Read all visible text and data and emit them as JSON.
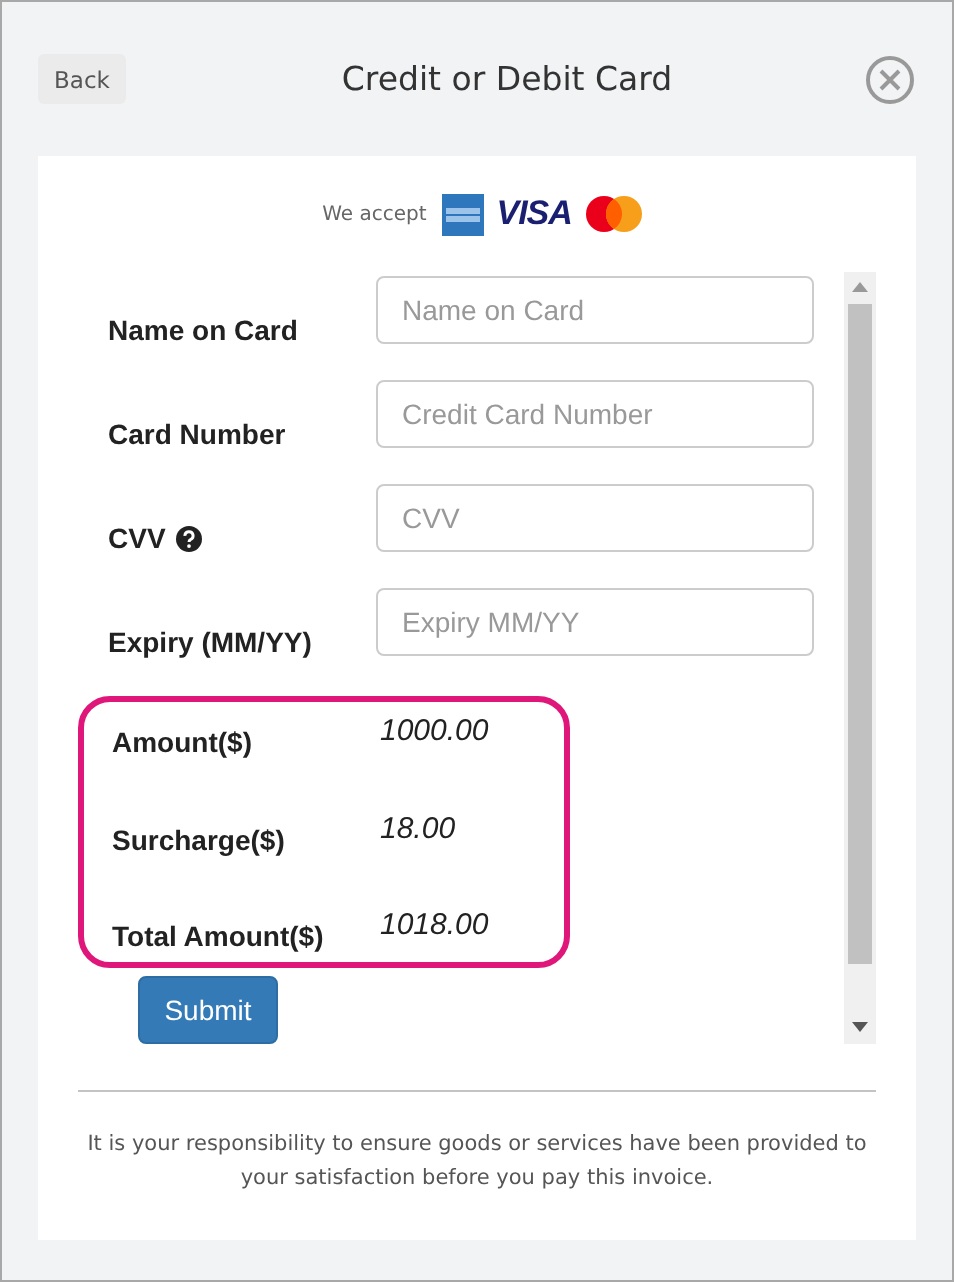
{
  "header": {
    "back_button": "Back",
    "title": "Credit or Debit Card"
  },
  "accepted": {
    "label": "We accept",
    "cards": [
      {
        "kind": "amex"
      },
      {
        "kind": "visa",
        "text": "VISA"
      },
      {
        "kind": "mastercard"
      }
    ]
  },
  "fields": [
    {
      "label": "Name on Card",
      "placeholder": "Name on Card",
      "help": false
    },
    {
      "label": "Card Number",
      "placeholder": "Credit Card Number",
      "help": false
    },
    {
      "label": "CVV",
      "placeholder": "CVV",
      "help": true
    },
    {
      "label": "Expiry (MM/YY)",
      "placeholder": "Expiry MM/YY",
      "help": false
    }
  ],
  "summary": [
    {
      "label": "Amount($)",
      "value": "1000.00"
    },
    {
      "label": "Surcharge($)",
      "value": "18.00"
    },
    {
      "label": "Total Amount($)",
      "value": "1018.00"
    }
  ],
  "submit_button": "Submit",
  "notice": "It is your responsibility to ensure goods or services have been provided to your satisfaction before you pay this invoice."
}
